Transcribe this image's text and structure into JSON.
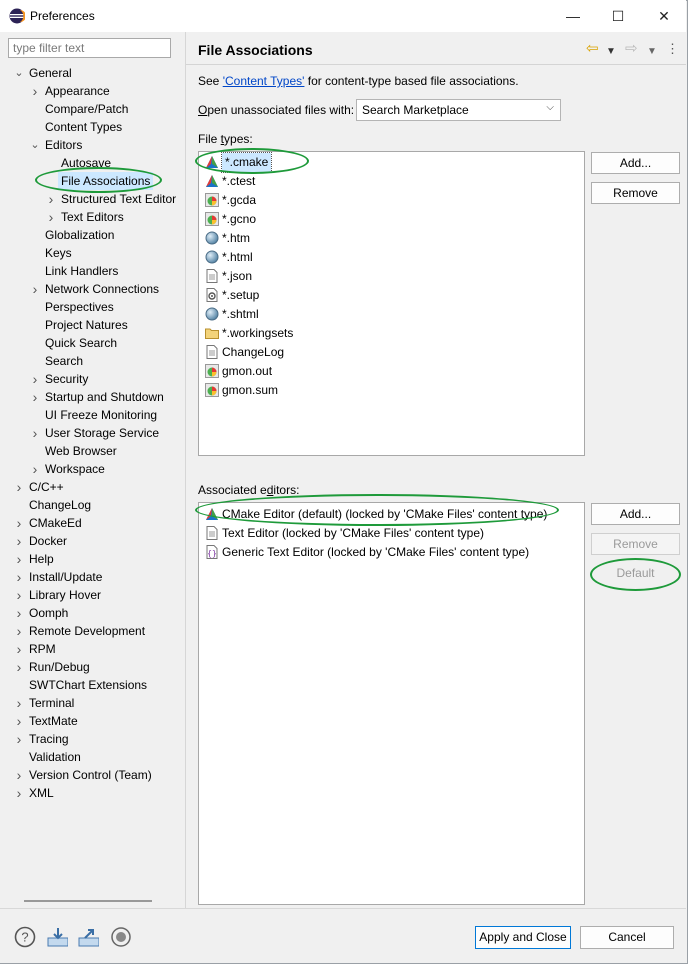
{
  "window": {
    "title": "Preferences",
    "controls": [
      "minimize",
      "maximize",
      "close"
    ]
  },
  "filter": {
    "placeholder": "type filter text"
  },
  "tree": [
    {
      "label": "General",
      "level": 0,
      "state": "expanded"
    },
    {
      "label": "Appearance",
      "level": 1,
      "state": "collapsed"
    },
    {
      "label": "Compare/Patch",
      "level": 1,
      "state": "leaf"
    },
    {
      "label": "Content Types",
      "level": 1,
      "state": "leaf"
    },
    {
      "label": "Editors",
      "level": 1,
      "state": "expanded"
    },
    {
      "label": "Autosave",
      "level": 2,
      "state": "leaf"
    },
    {
      "label": "File Associations",
      "level": 2,
      "state": "leaf",
      "selected": true
    },
    {
      "label": "Structured Text Editor",
      "level": 2,
      "state": "collapsed"
    },
    {
      "label": "Text Editors",
      "level": 2,
      "state": "collapsed"
    },
    {
      "label": "Globalization",
      "level": 1,
      "state": "leaf"
    },
    {
      "label": "Keys",
      "level": 1,
      "state": "leaf"
    },
    {
      "label": "Link Handlers",
      "level": 1,
      "state": "leaf"
    },
    {
      "label": "Network Connections",
      "level": 1,
      "state": "collapsed"
    },
    {
      "label": "Perspectives",
      "level": 1,
      "state": "leaf"
    },
    {
      "label": "Project Natures",
      "level": 1,
      "state": "leaf"
    },
    {
      "label": "Quick Search",
      "level": 1,
      "state": "leaf"
    },
    {
      "label": "Search",
      "level": 1,
      "state": "leaf"
    },
    {
      "label": "Security",
      "level": 1,
      "state": "collapsed"
    },
    {
      "label": "Startup and Shutdown",
      "level": 1,
      "state": "collapsed"
    },
    {
      "label": "UI Freeze Monitoring",
      "level": 1,
      "state": "leaf"
    },
    {
      "label": "User Storage Service",
      "level": 1,
      "state": "collapsed"
    },
    {
      "label": "Web Browser",
      "level": 1,
      "state": "leaf"
    },
    {
      "label": "Workspace",
      "level": 1,
      "state": "collapsed"
    },
    {
      "label": "C/C++",
      "level": 0,
      "state": "collapsed"
    },
    {
      "label": "ChangeLog",
      "level": 0,
      "state": "leaf"
    },
    {
      "label": "CMakeEd",
      "level": 0,
      "state": "collapsed"
    },
    {
      "label": "Docker",
      "level": 0,
      "state": "collapsed"
    },
    {
      "label": "Help",
      "level": 0,
      "state": "collapsed"
    },
    {
      "label": "Install/Update",
      "level": 0,
      "state": "collapsed"
    },
    {
      "label": "Library Hover",
      "level": 0,
      "state": "collapsed"
    },
    {
      "label": "Oomph",
      "level": 0,
      "state": "collapsed"
    },
    {
      "label": "Remote Development",
      "level": 0,
      "state": "collapsed"
    },
    {
      "label": "RPM",
      "level": 0,
      "state": "collapsed"
    },
    {
      "label": "Run/Debug",
      "level": 0,
      "state": "collapsed"
    },
    {
      "label": "SWTChart Extensions",
      "level": 0,
      "state": "leaf"
    },
    {
      "label": "Terminal",
      "level": 0,
      "state": "collapsed"
    },
    {
      "label": "TextMate",
      "level": 0,
      "state": "collapsed"
    },
    {
      "label": "Tracing",
      "level": 0,
      "state": "collapsed"
    },
    {
      "label": "Validation",
      "level": 0,
      "state": "leaf"
    },
    {
      "label": "Version Control (Team)",
      "level": 0,
      "state": "collapsed"
    },
    {
      "label": "XML",
      "level": 0,
      "state": "collapsed"
    }
  ],
  "page": {
    "title": "File Associations",
    "see_prefix": "See ",
    "content_types_link": "'Content Types'",
    "see_suffix": " for content-type based file associations.",
    "open_label_first": "O",
    "open_label_rest": "pen unassociated files with:",
    "open_with_value": "Search Marketplace",
    "file_types_label_a": "File ",
    "file_types_label_t": "t",
    "file_types_label_b": "ypes:",
    "assoc_label_a": "Associated e",
    "assoc_label_d": "d",
    "assoc_label_b": "itors:"
  },
  "file_types": [
    {
      "name": "*.cmake",
      "icon": "cmake-icon",
      "selected": true
    },
    {
      "name": "*.ctest",
      "icon": "cmake-icon"
    },
    {
      "name": "*.gcda",
      "icon": "gcov-icon"
    },
    {
      "name": "*.gcno",
      "icon": "gcov-icon"
    },
    {
      "name": "*.htm",
      "icon": "web-globe-icon"
    },
    {
      "name": "*.html",
      "icon": "web-globe-icon"
    },
    {
      "name": "*.json",
      "icon": "text-file-icon"
    },
    {
      "name": "*.setup",
      "icon": "setup-file-icon"
    },
    {
      "name": "*.shtml",
      "icon": "web-globe-icon"
    },
    {
      "name": "*.workingsets",
      "icon": "folder-icon"
    },
    {
      "name": "ChangeLog",
      "icon": "text-file-icon"
    },
    {
      "name": "gmon.out",
      "icon": "gcov-icon"
    },
    {
      "name": "gmon.sum",
      "icon": "gcov-icon"
    }
  ],
  "file_type_buttons": {
    "add": "Add...",
    "remove": "Remove"
  },
  "editors": [
    {
      "name": "CMake Editor (default) (locked by 'CMake Files' content type)",
      "icon": "cmake-icon"
    },
    {
      "name": "Text Editor (locked by 'CMake Files' content type)",
      "icon": "text-file-icon"
    },
    {
      "name": "Generic Text Editor (locked by 'CMake Files' content type)",
      "icon": "generic-editor-icon"
    }
  ],
  "editor_buttons": {
    "add": "Add...",
    "remove": "Remove",
    "default": "Default"
  },
  "footer": {
    "apply_close": "Apply and Close",
    "cancel": "Cancel"
  },
  "colors": {
    "highlight_ellipse": "#1e9a3a",
    "link": "#0046c8",
    "selection": "#cce8ff"
  }
}
